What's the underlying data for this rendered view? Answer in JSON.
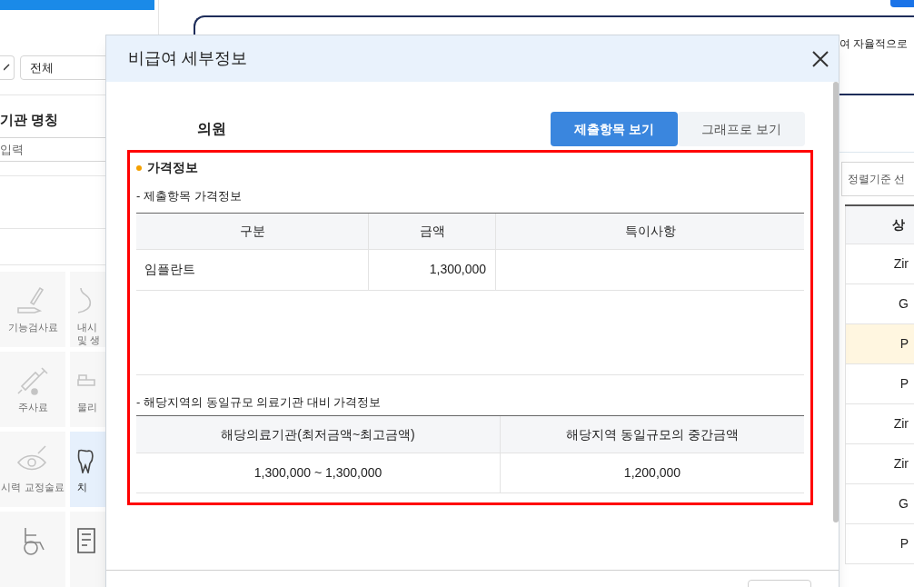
{
  "background": {
    "left_panel": {
      "filter_value": "전체",
      "section_title": "기관 명칭",
      "search_placeholder": "입력",
      "categories": [
        {
          "lines": [
            "기능검사료"
          ],
          "selected": false
        },
        {
          "lines": [
            "내시",
            "및 생"
          ],
          "selected": false
        },
        {
          "lines": [
            "주사료"
          ],
          "selected": false
        },
        {
          "lines": [
            "물리"
          ],
          "selected": false
        },
        {
          "lines": [
            "시력 교정술료"
          ],
          "selected": false
        },
        {
          "lines": [
            "치"
          ],
          "selected": true
        },
        {
          "selected": false
        },
        {
          "selected": false
        }
      ]
    },
    "right_panel": {
      "notice": "여 자율적으로",
      "sort_placeholder": "정렬기준 선",
      "table_header": "상",
      "rows": [
        {
          "text": "Zir",
          "selected": false
        },
        {
          "text": "G",
          "selected": false
        },
        {
          "text": "P",
          "selected": true
        },
        {
          "text": "P",
          "selected": false
        },
        {
          "text": "Zir",
          "selected": false
        },
        {
          "text": "Zir",
          "selected": false
        },
        {
          "text": "G",
          "selected": false
        },
        {
          "text": "P",
          "selected": false
        }
      ]
    }
  },
  "dialog": {
    "title": "비급여 세부정보",
    "institution_type": "의원",
    "tabs": [
      {
        "label": "제출항목 보기",
        "selected": true
      },
      {
        "label": "그래프로 보기",
        "selected": false
      }
    ],
    "section_title": "가격정보",
    "price_table": {
      "caption": "- 제출항목 가격정보",
      "columns": [
        "구분",
        "금액",
        "특이사항"
      ],
      "rows": [
        [
          "임플란트",
          "1,300,000"
        ]
      ]
    },
    "comparison_table": {
      "caption": "- 해당지역의 동일규모 의료기관 대비 가격정보",
      "columns": [
        "해당의료기관(최저금액~최고금액)",
        "해당지역 동일규모의 중간금액"
      ],
      "rows": [
        [
          "1,300,000 ~ 1,300,000",
          "1,200,000"
        ]
      ]
    }
  }
}
